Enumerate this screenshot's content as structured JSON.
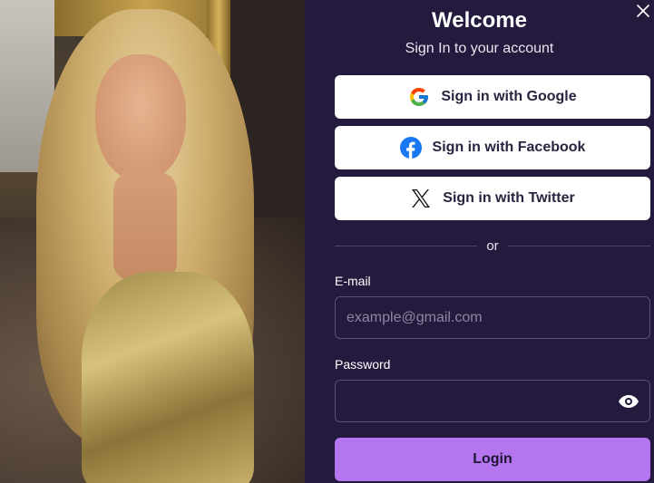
{
  "header": {
    "title": "Welcome",
    "subtitle": "Sign In to your account",
    "close_icon": "close-icon"
  },
  "social": {
    "google": {
      "label": "Sign in with Google",
      "icon": "google-icon"
    },
    "facebook": {
      "label": "Sign in with Facebook",
      "icon": "facebook-icon",
      "color": "#1877f2"
    },
    "twitter": {
      "label": "Sign in with Twitter",
      "icon": "x-twitter-icon"
    }
  },
  "divider": {
    "label": "or"
  },
  "form": {
    "email": {
      "label": "E-mail",
      "value": "",
      "placeholder": "example@gmail.com"
    },
    "password": {
      "label": "Password",
      "value": "",
      "placeholder": "",
      "toggle_icon": "eye-icon"
    },
    "login_label": "Login"
  },
  "colors": {
    "panel_bg": "#241a3d",
    "accent": "#b475ef",
    "button_bg": "#ffffff"
  }
}
